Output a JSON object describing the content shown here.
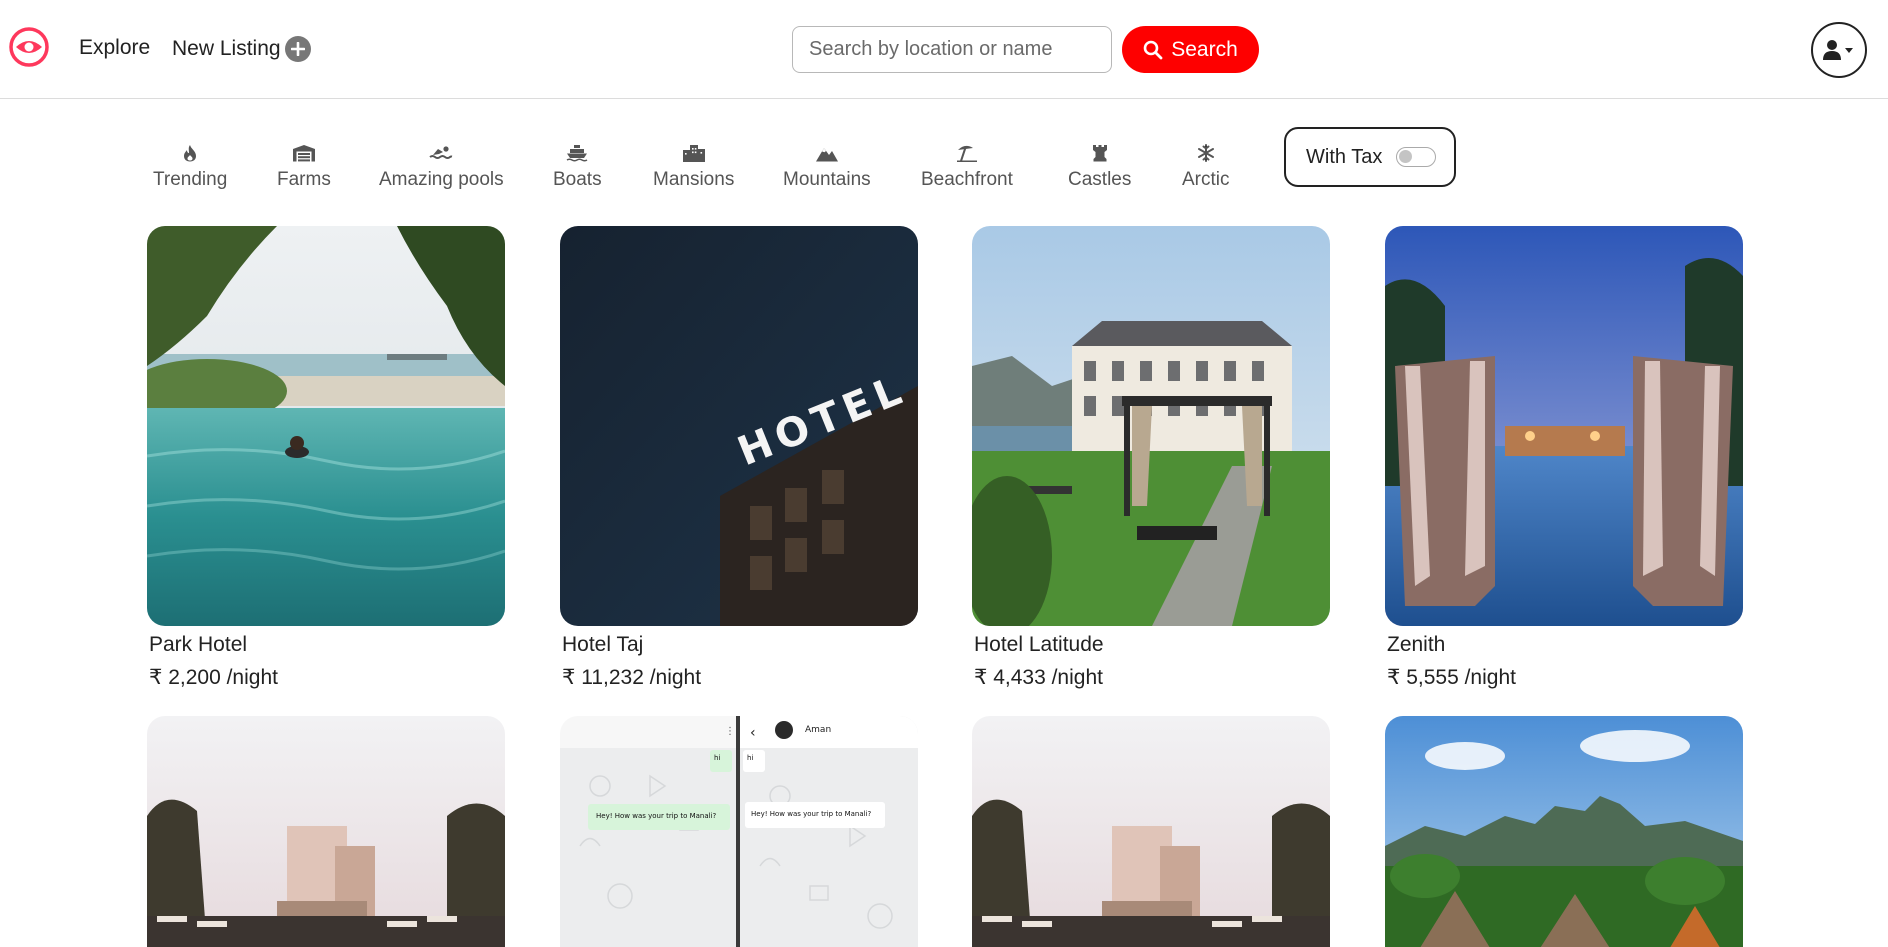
{
  "nav": {
    "explore_label": "Explore",
    "new_listing_label": "New Listing",
    "search_placeholder": "Search by location or name",
    "search_button_label": "Search"
  },
  "filters": [
    {
      "label": "Trending",
      "icon": "fire-icon"
    },
    {
      "label": "Farms",
      "icon": "warehouse-icon"
    },
    {
      "label": "Amazing pools",
      "icon": "swimmer-icon"
    },
    {
      "label": "Boats",
      "icon": "ship-icon"
    },
    {
      "label": "Mansions",
      "icon": "city-icon"
    },
    {
      "label": "Mountains",
      "icon": "mountain-icon"
    },
    {
      "label": "Beachfront",
      "icon": "umbrella-beach-icon"
    },
    {
      "label": "Castles",
      "icon": "chess-rook-icon"
    },
    {
      "label": "Arctic",
      "icon": "snowflake-icon"
    }
  ],
  "tax_toggle": {
    "label": "With Tax",
    "enabled": false
  },
  "listings": [
    {
      "name": "Park Hotel",
      "price": "₹ 2,200 /night"
    },
    {
      "name": "Hotel Taj",
      "price": "₹ 11,232 /night"
    },
    {
      "name": "Hotel Latitude",
      "price": "₹ 4,433 /night"
    },
    {
      "name": "Zenith",
      "price": "₹ 5,555 /night"
    }
  ],
  "listing_images_row2": [
    {
      "scene": "desert-villa-pool"
    },
    {
      "scene": "chat-screenshot",
      "chat_name": "Aman",
      "message": "Hey! How was your trip to Manali?",
      "reply": "hi"
    },
    {
      "scene": "desert-villa-pool"
    },
    {
      "scene": "tropical-mountain-resort"
    }
  ],
  "colors": {
    "brand": "#fe385c",
    "search_button": "#fe0000"
  }
}
